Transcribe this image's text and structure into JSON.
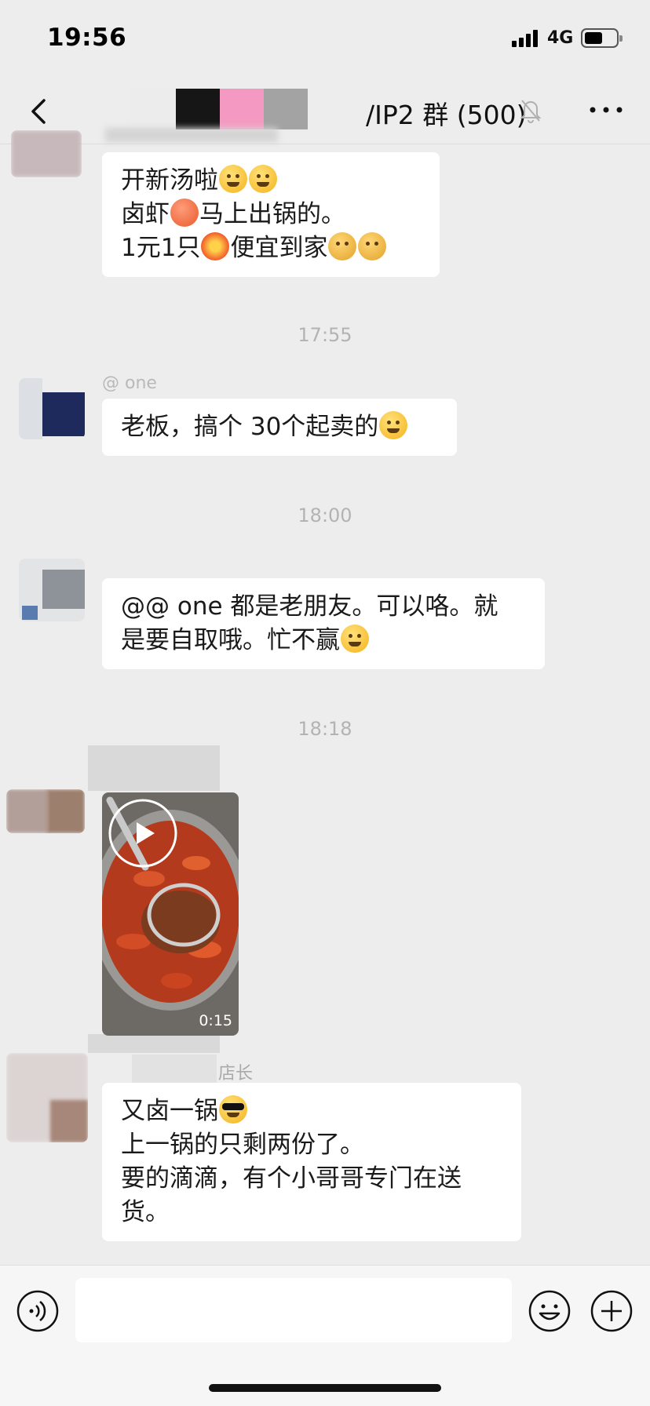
{
  "status_bar": {
    "time": "19:56",
    "network": "4G"
  },
  "header": {
    "title": "/IP2 群 (500)"
  },
  "messages": [
    {
      "lines": [
        {
          "t1": "开新汤啦",
          "emojis": [
            "eyes-666-emoji",
            "eyes-666-emoji"
          ]
        },
        {
          "t1": "卤虾",
          "emoji_mid": "shrimp-emoji",
          "t2": "马上出锅的。"
        },
        {
          "t1": "1元1只",
          "emoji_mid": "boom-emoji",
          "t2": "便宜到家",
          "emojis": [
            "kiss-emoji",
            "kiss-emoji"
          ]
        }
      ]
    },
    {
      "time": "17:55",
      "sender": "@ one",
      "text": "老板，搞个 30个起卖的"
    },
    {
      "time": "18:00",
      "lines": [
        "@@ one 都是老朋友。可以咯。就",
        "是要自取哦。忙不赢"
      ]
    },
    {
      "time": "18:18",
      "video": {
        "duration": "0:15"
      }
    },
    {
      "sender": "店长",
      "lines": [
        "又卤一锅",
        "上一锅的只剩两份了。",
        "要的滴滴，有个小哥哥专门在送",
        "货。"
      ]
    }
  ],
  "input": {
    "placeholder": ""
  }
}
